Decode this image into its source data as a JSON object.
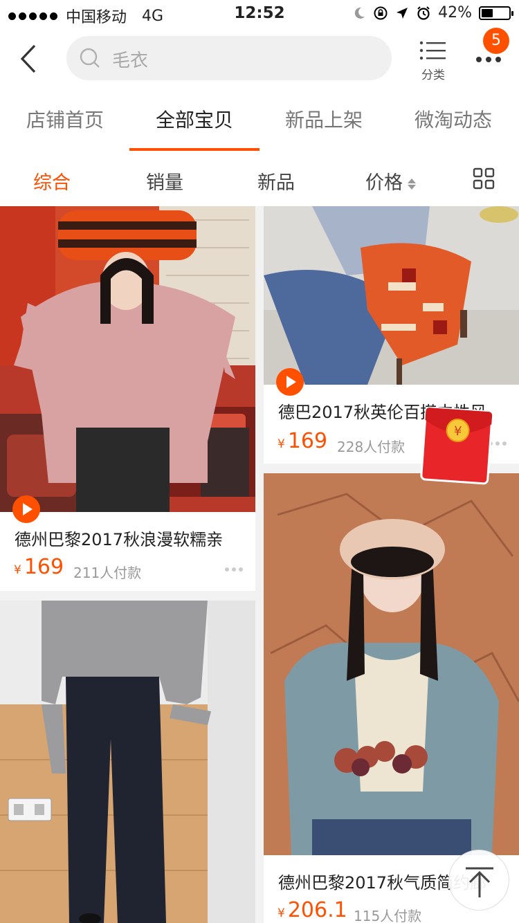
{
  "status_bar": {
    "carrier": "中国移动",
    "network": "4G",
    "time": "12:52",
    "battery_text": "42%",
    "battery_level": 0.42
  },
  "nav": {
    "search_placeholder": "毛衣",
    "category_label": "分类",
    "message_badge": "5"
  },
  "tabs": [
    {
      "label": "店铺首页"
    },
    {
      "label": "全部宝贝"
    },
    {
      "label": "新品上架"
    },
    {
      "label": "微淘动态"
    }
  ],
  "active_tab": "全部宝贝",
  "sort": [
    {
      "label": "综合"
    },
    {
      "label": "销量"
    },
    {
      "label": "新品"
    },
    {
      "label": "价格"
    }
  ],
  "active_sort": "综合",
  "products": [
    {
      "title": "德州巴黎2017秋浪漫软糯亲",
      "currency": "¥",
      "price": "169",
      "sales": "211人付款"
    },
    {
      "title": "德巴2017秋英伦百搭中性风",
      "currency": "¥",
      "price": "169",
      "sales": "228人付款"
    },
    {
      "title": "德州巴黎2017秋气质简约廊",
      "currency": "¥",
      "price": "206.1",
      "sales": "115人付款"
    },
    {
      "title": "",
      "currency": "",
      "price": "",
      "sales": ""
    }
  ],
  "colors": {
    "accent": "#ff5000",
    "red_packet": "#e8262a",
    "text_muted": "#999999"
  },
  "icons": [
    "back-arrow-icon",
    "search-icon",
    "list-icon",
    "more-icon",
    "sort-arrows-icon",
    "grid-view-icon",
    "play-icon",
    "red-packet-icon",
    "back-to-top-icon"
  ]
}
